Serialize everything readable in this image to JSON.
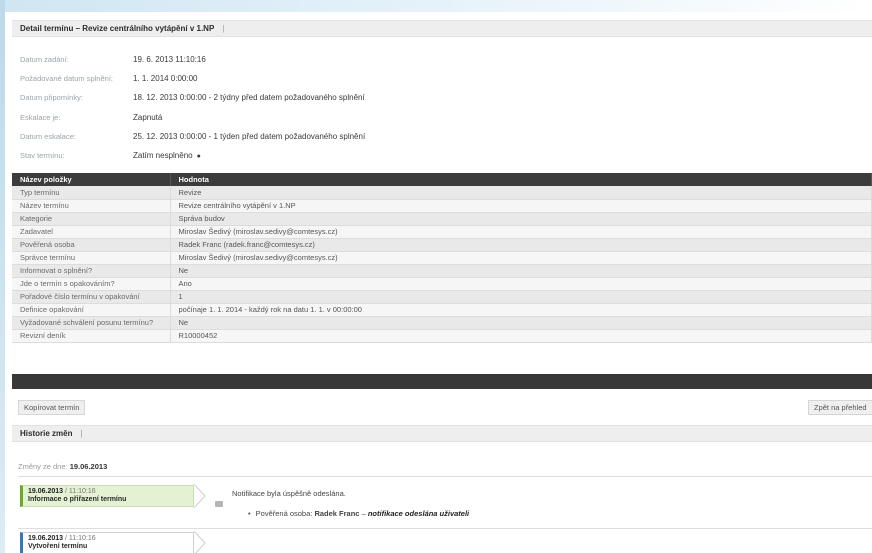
{
  "detail": {
    "header": "Detail termínu – Revize centrálního vytápění v 1.NP",
    "header_sep": "|",
    "info": [
      {
        "label": "Datum zadání:",
        "value": "19. 6. 2013 11:10:16"
      },
      {
        "label": "Požadované datum splnění:",
        "value": "1. 1. 2014 0:00:00"
      },
      {
        "label": "Datum připomínky:",
        "value": "18. 12. 2013 0:00:00 - 2 týdny před datem požadovaného splnění"
      },
      {
        "label": "Eskalace je:",
        "value": "Zapnutá"
      },
      {
        "label": "Datum eskalace:",
        "value": "25. 12. 2013 0:00:00 - 1 týden před datem požadovaného splnění"
      },
      {
        "label": "Stav termínu:",
        "value": "Zatím nesplněno",
        "icon": "dot-icon"
      }
    ]
  },
  "table": {
    "headers": [
      "Název položky",
      "Hodnota"
    ],
    "rows": [
      [
        "Typ termínu",
        "Revize"
      ],
      [
        "Název termínu",
        "Revize centrálního vytápění v 1.NP"
      ],
      [
        "Kategorie",
        "Správa budov"
      ],
      [
        "Zadavatel",
        "Miroslav Šedivý (miroslav.sedivy@comtesys.cz)"
      ],
      [
        "Pověřená osoba",
        "Radek Franc (radek.franc@comtesys.cz)"
      ],
      [
        "Správce termínu",
        "Miroslav Šedivý (miroslav.sedivy@comtesys.cz)"
      ],
      [
        "Informovat o splnění?",
        "Ne"
      ],
      [
        "Jde o termín s opakováním?",
        "Ano"
      ],
      [
        "Pořadové číslo termínu v opakování",
        "1"
      ],
      [
        "Definice opakování",
        "počínaje 1. 1. 2014 - každý rok na datu 1. 1. v 00:00:00"
      ],
      [
        "Vyžadované schválení posunu termínu?",
        "Ne"
      ],
      [
        "Revizní deník",
        "R10000452"
      ]
    ]
  },
  "buttons": {
    "copy": "Kopírovat termín",
    "back": "Zpět na přehled"
  },
  "history": {
    "header": "Historie změn",
    "header_sep": "|",
    "date_label": "Změny ze dne:",
    "date_value": "19.06.2013",
    "entries": [
      {
        "date": "19.06.2013",
        "time": "11:10:16",
        "title": "Informace o přiřazení termínu"
      },
      {
        "date": "19.06.2013",
        "time": "11:10:16",
        "title": "Vytvoření termínu"
      }
    ],
    "notification": "Notifikace byla úspěšně odeslána.",
    "bullet_label": "Pověřená osoba:",
    "bullet_person": "Radek Franc",
    "bullet_dash": "–",
    "bullet_status": "notifikace odeslána uživateli"
  }
}
